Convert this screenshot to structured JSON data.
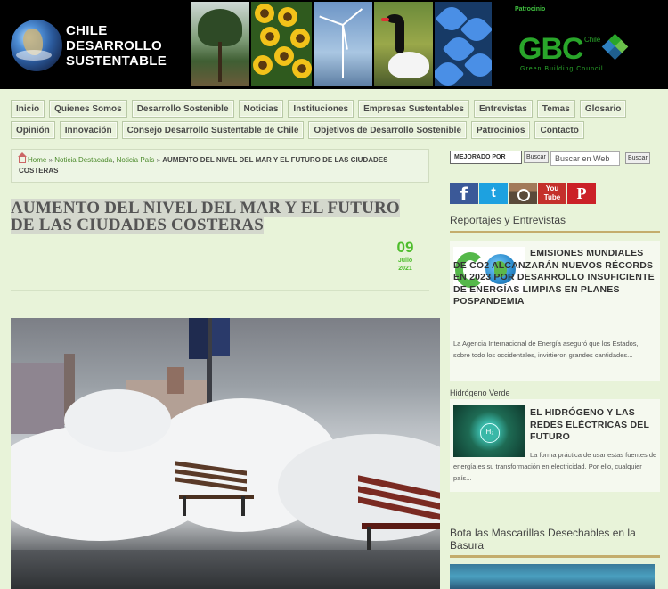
{
  "header": {
    "logo_lines": [
      "CHILE",
      "DESARROLLO",
      "SUSTENTABLE"
    ],
    "sponsor_label": "Patrocinio",
    "sponsor_name": "GBC",
    "sponsor_chile": "Chile",
    "sponsor_sub": "Green Building Council"
  },
  "nav": {
    "row1": [
      "Inicio",
      "Quienes Somos",
      "Desarrollo Sostenible",
      "Noticias",
      "Instituciones",
      "Empresas Sustentables",
      "Entrevistas",
      "Temas",
      "Glosario"
    ],
    "row2": [
      "Opinión",
      "Innovación",
      "Consejo Desarrollo Sustentable de Chile",
      "Objetivos de Desarrollo Sostenible",
      "Patrocinios",
      "Contacto"
    ]
  },
  "breadcrumb": {
    "home": "Home",
    "sep": "»",
    "cat1": "Noticia Destacada",
    "cat2": "Noticia País",
    "current": "AUMENTO DEL NIVEL DEL MAR Y EL FUTURO DE LAS CIUDADES COSTERAS"
  },
  "article": {
    "title": "AUMENTO DEL NIVEL DEL MAR Y EL FUTURO DE LAS CIUDADES COSTERAS",
    "day": "09",
    "month": "Julio",
    "year": "2021"
  },
  "search": {
    "select_value": "MEJORADO POR",
    "select_btn": "Buscar",
    "input_placeholder": "Buscar en Web",
    "input_btn": "Buscar"
  },
  "social": {
    "youtube_top": "You",
    "youtube_bottom": "Tube"
  },
  "sidebar": {
    "section1": "Reportajes y Entrevistas",
    "card1_head": "EMISIONES MUNDIALES DE CO2 ALCANZARÁN NUEVOS RÉCORDS EN 2023 POR DESARROLLO INSUFICIENTE DE ENERGÍAS LIMPIAS EN PLANES POSPANDEMIA",
    "card1_text": "La Agencia Internacional de Energía aseguró que los Estados, sobre todo los occidentales, invirtieron grandes cantidades...",
    "label2": "Hidrógeno Verde",
    "card2_head": "EL HIDRÓGENO Y LAS REDES ELÉCTRICAS DEL FUTURO",
    "card2_text": "La forma práctica de usar estas fuentes de energía es su transformación en electricidad. Por ello, cualquier país...",
    "section3": "Bota las Mascarillas Desechables en la Basura"
  }
}
